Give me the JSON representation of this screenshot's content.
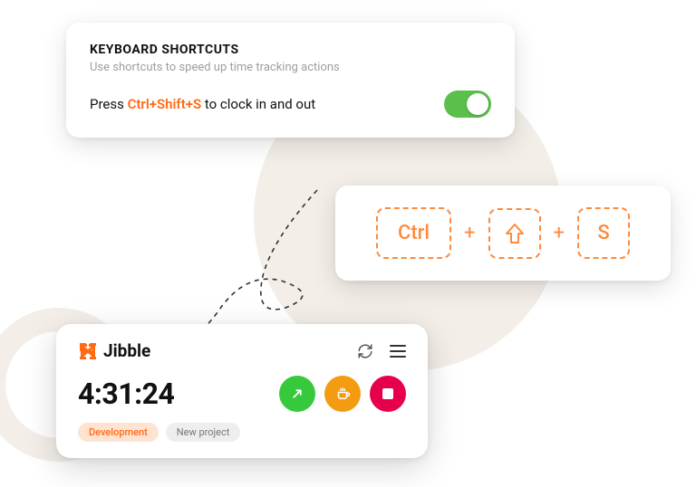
{
  "shortcuts": {
    "title": "KEYBOARD SHORTCUTS",
    "subtitle": "Use shortcuts to speed up time tracking actions",
    "press_prefix": "Press ",
    "hotkey": "Ctrl+Shift+S",
    "press_suffix": " to clock in and out",
    "toggle_on": true
  },
  "keys": {
    "k1": "Ctrl",
    "plus": "+",
    "k2_icon": "shift-up-arrow",
    "k3": "S"
  },
  "timer": {
    "brand": "Jibble",
    "time": "4:31:24",
    "tag_dev": "Development",
    "tag_proj": "New project"
  }
}
